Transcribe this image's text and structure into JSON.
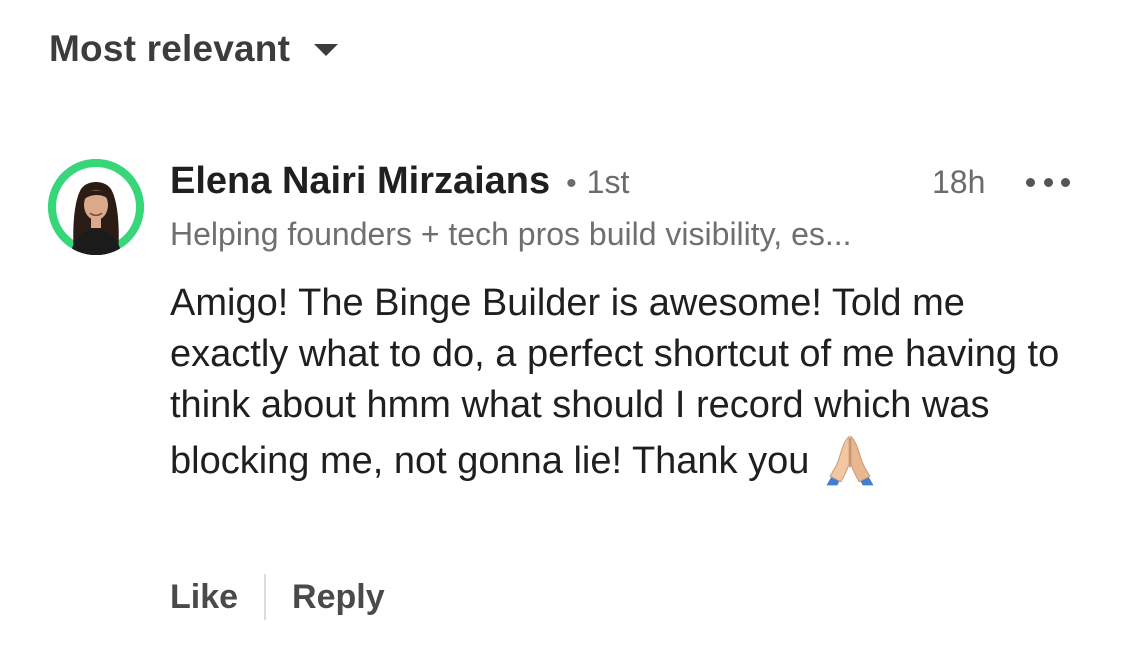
{
  "sort": {
    "label": "Most relevant"
  },
  "comment": {
    "author": "Elena Nairi Mirzaians",
    "separator": "•",
    "degree": "1st",
    "timestamp": "18h",
    "headline": "Helping founders + tech pros build visibility, es...",
    "text": "Amigo! The Binge Builder is awesome! Told me exactly what to do, a perfect shortcut of me having to think about hmm what should I record which was blocking me, not gonna lie! Thank you",
    "emoji": "folded-hands",
    "avatar_ring_color": "#37d67a"
  },
  "actions": {
    "like_label": "Like",
    "reply_label": "Reply"
  }
}
